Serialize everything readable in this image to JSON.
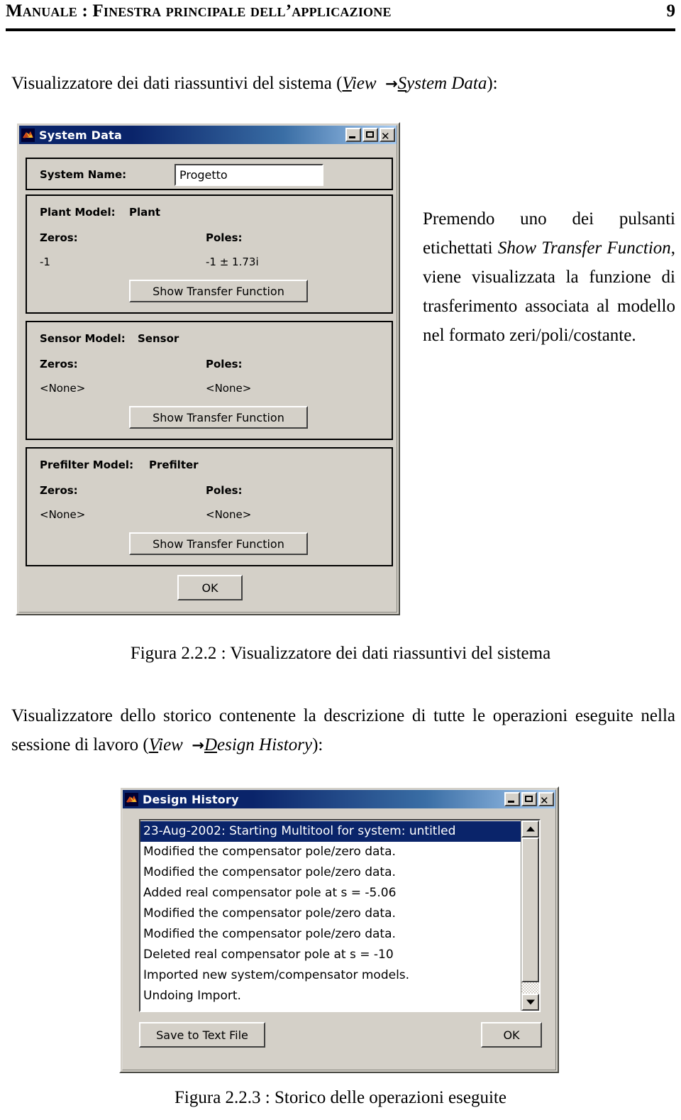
{
  "header": {
    "title": "Manuale : Finestra principale dell’applicazione",
    "page_number": "9"
  },
  "intro": {
    "text_before": "Visualizzatore dei dati riassuntivi del sistema (",
    "menu_root": "View",
    "menu_root_initial": "V",
    "menu_root_rest": "iew",
    "arrow": "→",
    "menu_item": "System Data",
    "menu_item_initial": "S",
    "menu_item_rest": "ystem Data",
    "text_after": "):"
  },
  "system_data_window": {
    "title": "System Data",
    "icon": "matlab-membrane-icon",
    "window_buttons": {
      "minimize": "minimize-icon",
      "maximize": "maximize-icon",
      "close": "close-icon"
    },
    "system_name": {
      "label": "System Name:",
      "value": "Progetto"
    },
    "models": [
      {
        "model_label": "Plant Model:",
        "model_name": "Plant",
        "zeros_label": "Zeros:",
        "poles_label": "Poles:",
        "zeros_value": "-1",
        "poles_value": "-1 ± 1.73i",
        "button_label": "Show Transfer Function"
      },
      {
        "model_label": "Sensor Model:",
        "model_name": "Sensor",
        "zeros_label": "Zeros:",
        "poles_label": "Poles:",
        "zeros_value": "<None>",
        "poles_value": "<None>",
        "button_label": "Show Transfer Function"
      },
      {
        "model_label": "Prefilter Model:",
        "model_name": "Prefilter",
        "zeros_label": "Zeros:",
        "poles_label": "Poles:",
        "zeros_value": "<None>",
        "poles_value": "<None>",
        "button_label": "Show Transfer Function"
      }
    ],
    "ok_label": "OK"
  },
  "right_paragraph": {
    "seg1": "Premendo uno dei pulsanti etichettati ",
    "seg2_italic": "Show Transfer Function",
    "seg3": ", viene visualizzata la funzione di trasferimento associata al modello nel formato zeri/poli/costante."
  },
  "caption_1": "Figura 2.2.2 : Visualizzatore dei dati riassuntivi del sistema",
  "mid_paragraph": {
    "seg1": "Visualizzatore dello storico contenente la descrizione di tutte le operazioni eseguite nella sessione di lavoro (",
    "menu_root_initial": "V",
    "menu_root_rest": "iew",
    "arrow": "→",
    "menu_item_initial": "D",
    "menu_item_rest": "esign History",
    "seg_end": "):"
  },
  "design_history_window": {
    "title": "Design History",
    "icon": "matlab-membrane-icon",
    "window_buttons": {
      "minimize": "minimize-icon",
      "maximize": "maximize-icon",
      "close": "close-icon"
    },
    "list_items": [
      "23-Aug-2002: Starting Multitool for system: untitled",
      "Modified the compensator pole/zero data.",
      "Modified the compensator pole/zero data.",
      "Added real compensator pole at s = -5.06",
      "Modified the compensator pole/zero data.",
      "Modified the compensator pole/zero data.",
      "Deleted real compensator pole at s = -10",
      "Imported new system/compensator models.",
      "Undoing Import."
    ],
    "selected_index": 0,
    "save_button_label": "Save to Text File",
    "ok_label": "OK"
  },
  "caption_2": "Figura 2.2.3 : Storico delle operazioni eseguite",
  "colors": {
    "dialog_face": "#d4d0c8",
    "titlebar_start": "#0a246a",
    "titlebar_end": "#a6caf0",
    "selection": "#0a246a",
    "text": "#000000"
  }
}
